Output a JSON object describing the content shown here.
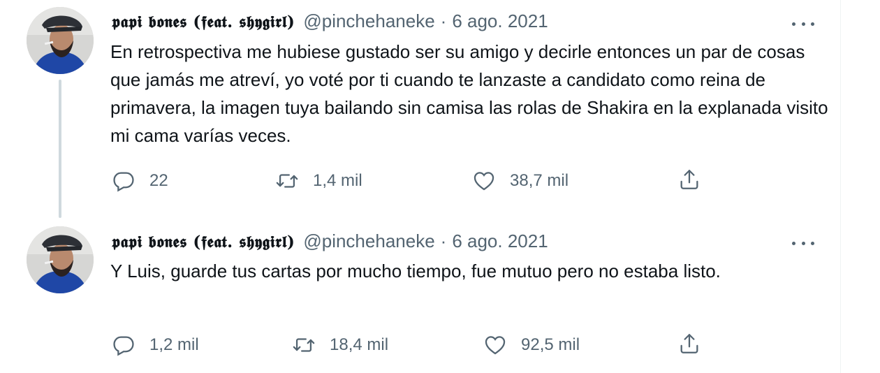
{
  "tweets": [
    {
      "display_name": "𝖕𝖆𝖕𝖎 𝖇𝖔𝖓𝖊𝖘 (𝖋𝖊𝖆𝖙. 𝖘𝖍𝖞𝖌𝖎𝖗𝖑)",
      "handle": "@pinchehaneke",
      "separator": "·",
      "date": "6 ago. 2021",
      "text": "En retrospectiva me hubiese gustado ser su amigo y decirle entonces un par de cosas que jamás me atreví, yo voté por ti cuando te lanzaste a candidato como reina de primavera, la imagen tuya bailando sin camisa las rolas de Shakira en la explanada visito mi cama varías veces.",
      "replies": "22",
      "retweets": "1,4 mil",
      "likes": "38,7 mil"
    },
    {
      "display_name": "𝖕𝖆𝖕𝖎 𝖇𝖔𝖓𝖊𝖘 (𝖋𝖊𝖆𝖙. 𝖘𝖍𝖞𝖌𝖎𝖗𝖑)",
      "handle": "@pinchehaneke",
      "separator": "·",
      "date": "6 ago. 2021",
      "text": "Y Luis, guarde tus cartas por mucho tiempo, fue mutuo pero no estaba listo.",
      "replies": "1,2 mil",
      "retweets": "18,4 mil",
      "likes": "92,5 mil"
    }
  ],
  "icons": {
    "reply": "reply-icon",
    "retweet": "retweet-icon",
    "like": "heart-icon",
    "share": "share-icon",
    "more": "more-icon"
  },
  "colors": {
    "text": "#0f1419",
    "secondary": "#536471",
    "thread_line": "#cfd9de"
  }
}
